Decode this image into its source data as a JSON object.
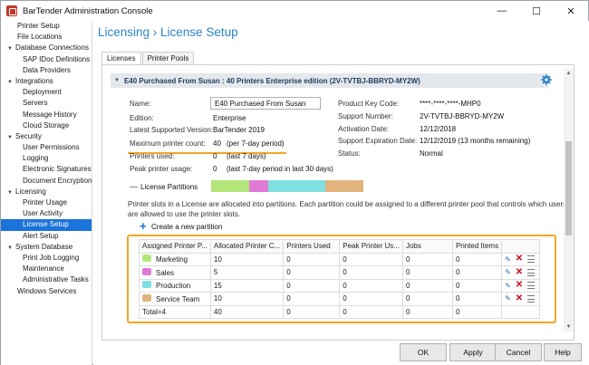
{
  "window": {
    "title": "BarTender Administration Console"
  },
  "sidebar": {
    "items": [
      {
        "label": "Printer Setup",
        "level": 1
      },
      {
        "label": "File Locations",
        "level": 1
      },
      {
        "label": "Database Connections",
        "level": 0
      },
      {
        "label": "SAP IDoc Definitions",
        "level": 2
      },
      {
        "label": "Data Providers",
        "level": 2
      },
      {
        "label": "Integrations",
        "level": 0
      },
      {
        "label": "Deployment",
        "level": 2
      },
      {
        "label": "Servers",
        "level": 2
      },
      {
        "label": "Message History",
        "level": 2
      },
      {
        "label": "Cloud Storage",
        "level": 2
      },
      {
        "label": "Security",
        "level": 0
      },
      {
        "label": "User Permissions",
        "level": 2
      },
      {
        "label": "Logging",
        "level": 2
      },
      {
        "label": "Electronic Signatures",
        "level": 2
      },
      {
        "label": "Document Encryption",
        "level": 2
      },
      {
        "label": "Licensing",
        "level": 0
      },
      {
        "label": "Printer Usage",
        "level": 2
      },
      {
        "label": "User Activity",
        "level": 2
      },
      {
        "label": "License Setup",
        "level": 2,
        "selected": true
      },
      {
        "label": "Alert Setup",
        "level": 2
      },
      {
        "label": "System Database",
        "level": 0
      },
      {
        "label": "Print Job Logging",
        "level": 2
      },
      {
        "label": "Maintenance",
        "level": 2
      },
      {
        "label": "Administrative Tasks",
        "level": 2
      },
      {
        "label": "Windows Services",
        "level": 1
      }
    ]
  },
  "breadcrumb": "Licensing › License Setup",
  "tabs": [
    "Licenses",
    "Printer Pools"
  ],
  "license": {
    "header": "E40 Purchased From Susan : 40 Printers Enterprise edition (2V-TVTBJ-BBRYD-MY2W)",
    "left": {
      "name_label": "Name:",
      "name_value": "E40 Purchased From Susan",
      "edition_label": "Edition:",
      "edition_value": "Enterprise",
      "latest_label": "Latest Supported Version:",
      "latest_value": "BarTender 2019",
      "max_label": "Maximum printer count:",
      "max_value": "40",
      "max_note": "(per 7-day period)",
      "used_label": "Printers used:",
      "used_value": "0",
      "used_note": "(last 7 days)",
      "peak_label": "Peak printer usage:",
      "peak_value": "0",
      "peak_note": "(last 7-day period in last 30 days)"
    },
    "right": {
      "pk_label": "Product Key Code:",
      "pk_value": "****-****-****-MHP0",
      "sn_label": "Support Number:",
      "sn_value": "2V-TVTBJ-BBRYD-MY2W",
      "act_label": "Activation Date:",
      "act_value": "12/12/2018",
      "exp_label": "Support Expiration Date:",
      "exp_value": "12/12/2019 (13 months remaining)",
      "status_label": "Status:",
      "status_value": "Normal"
    }
  },
  "partitions": {
    "title": "License Partitions",
    "description": "Printer slots in a License are allocated into partitions. Each partition could be assigned to a different printer pool that controls which users are allowed to use the printer slots.",
    "create_label": "Create a new partition",
    "bar_colors": [
      "#b3e67a",
      "#e07ad6",
      "#7ee0e0",
      "#e2b37a"
    ],
    "bar_values": [
      10,
      5,
      15,
      10
    ],
    "columns": [
      "Assigned Printer P...",
      "Allocated Printer C...",
      "Printers Used",
      "Peak Printer Us...",
      "Jobs",
      "Printed Items"
    ],
    "rows": [
      {
        "name": "Marketing",
        "color": "#b3e67a",
        "allocated": "10",
        "used": "0",
        "peak": "0",
        "jobs": "0",
        "items": "0"
      },
      {
        "name": "Sales",
        "color": "#e07ad6",
        "allocated": "5",
        "used": "0",
        "peak": "0",
        "jobs": "0",
        "items": "0"
      },
      {
        "name": "Production",
        "color": "#7ee0e0",
        "allocated": "15",
        "used": "0",
        "peak": "0",
        "jobs": "0",
        "items": "0"
      },
      {
        "name": "Service Team",
        "color": "#e2b37a",
        "allocated": "10",
        "used": "0",
        "peak": "0",
        "jobs": "0",
        "items": "0"
      }
    ],
    "total": {
      "name": "Total=4",
      "allocated": "40",
      "used": "0",
      "peak": "0",
      "jobs": "0",
      "items": "0"
    }
  },
  "buttons": {
    "ok": "OK",
    "apply": "Apply",
    "cancel": "Cancel",
    "help": "Help"
  },
  "colors": {
    "accent": "#1a73d9",
    "highlight": "#f5a623",
    "title": "#2e84c6"
  }
}
